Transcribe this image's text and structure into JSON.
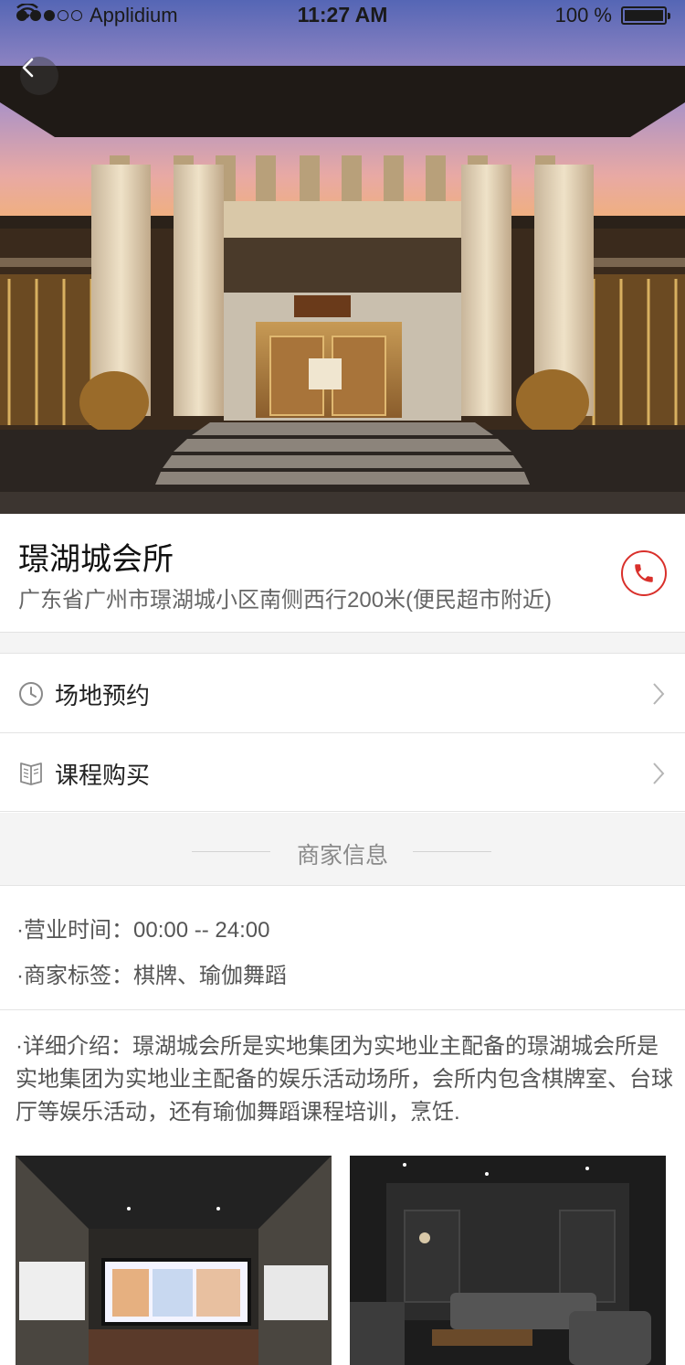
{
  "status_bar": {
    "carrier": "Applidium",
    "time": "11:27 AM",
    "battery": "100 %",
    "battery_level": 1.0
  },
  "header": {
    "back_icon": "chevron-left-icon"
  },
  "venue": {
    "name": "璟湖城会所",
    "address": "广东省广州市璟湖城小区南侧西行200米(便民超市附近)",
    "phone_icon": "phone-icon",
    "accent_color": "#d9302b"
  },
  "menu": [
    {
      "label": "场地预约",
      "icon": "clock-icon"
    },
    {
      "label": "课程购买",
      "icon": "book-icon"
    }
  ],
  "merchant_section": {
    "title": "商家信息",
    "hours_label": "·营业时间：",
    "hours_value": "00:00 -- 24:00",
    "tags_label": "·商家标签：",
    "tags_value": "棋牌、瑜伽舞蹈"
  },
  "description": {
    "label": "·详细介绍：",
    "text": "璟湖城会所是实地集团为实地业主配备的璟湖城会所是实地集团为实地业主配备的娱乐活动场所，会所内包含棋牌室、台球厅等娱乐活动，还有瑜伽舞蹈课程培训，烹饪."
  }
}
